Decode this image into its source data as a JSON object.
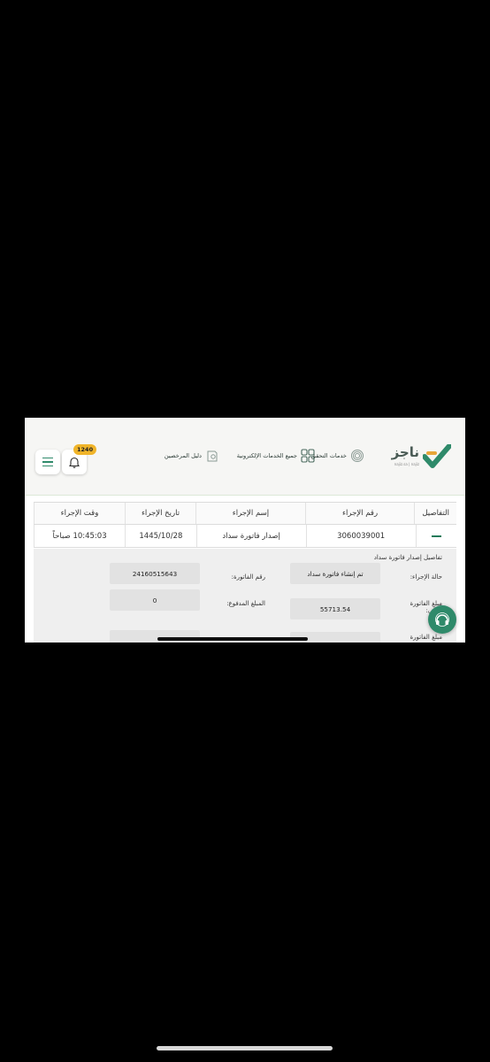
{
  "header": {
    "logo_text": "ناجز",
    "logo_subtext": "najiz.sa | najiz",
    "nav": [
      {
        "label": "خدمات التحقق",
        "icon": "fingerprint-icon"
      },
      {
        "label": "جميع الخدمات الإلكترونية",
        "icon": "grid-icon"
      },
      {
        "label": "دليل المرخصين",
        "icon": "license-guide-icon"
      }
    ],
    "notification_count": "1240",
    "accent_color": "#2f8a6a",
    "badge_color": "#f0b429"
  },
  "table": {
    "headers": [
      "التفاصيل",
      "رقم الإجراء",
      "إسم الإجراء",
      "تاريخ الإجراء",
      "وقت الإجراء"
    ],
    "rows": [
      {
        "procedure_number": "3060039001",
        "procedure_name": "إصدار فاتورة سداد",
        "procedure_date": "1445/10/28",
        "procedure_time": "10:45:03 صباحاً"
      }
    ]
  },
  "details": {
    "title": "تفاصيل إصدار فاتورة سداد",
    "status_label": "حالة الإجراء:",
    "status_value": "تم إنشاء فاتورة سداد",
    "invoice_number_label": "رقم الفاتورة:",
    "invoice_number_value": "24160515643",
    "total_amount_label": "مبلغ الفاتورة الكلي:",
    "total_amount_value": "55713.54",
    "paid_amount_label": "المبلغ المدفوع:",
    "paid_amount_value": "0",
    "partial_label": "مبلغ الفاتورة"
  }
}
